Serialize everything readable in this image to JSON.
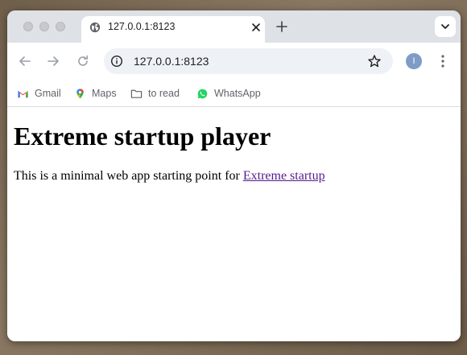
{
  "browser": {
    "tab": {
      "title": "127.0.0.1:8123"
    },
    "address_bar": {
      "url": "127.0.0.1:8123"
    },
    "profile_initial": "I",
    "bookmarks": [
      {
        "label": "Gmail",
        "icon": "gmail-icon"
      },
      {
        "label": "Maps",
        "icon": "maps-icon"
      },
      {
        "label": "to read",
        "icon": "folder-icon"
      },
      {
        "label": "WhatsApp",
        "icon": "whatsapp-icon"
      }
    ]
  },
  "page": {
    "heading": "Extreme startup player",
    "intro_text": "This is a minimal web app starting point for ",
    "link_text": "Extreme startup"
  },
  "colors": {
    "tabstrip": "#dee1e6",
    "omnibox": "#eef1f6",
    "link_visited": "#551a8b",
    "profile_avatar": "#7f9cc7"
  }
}
